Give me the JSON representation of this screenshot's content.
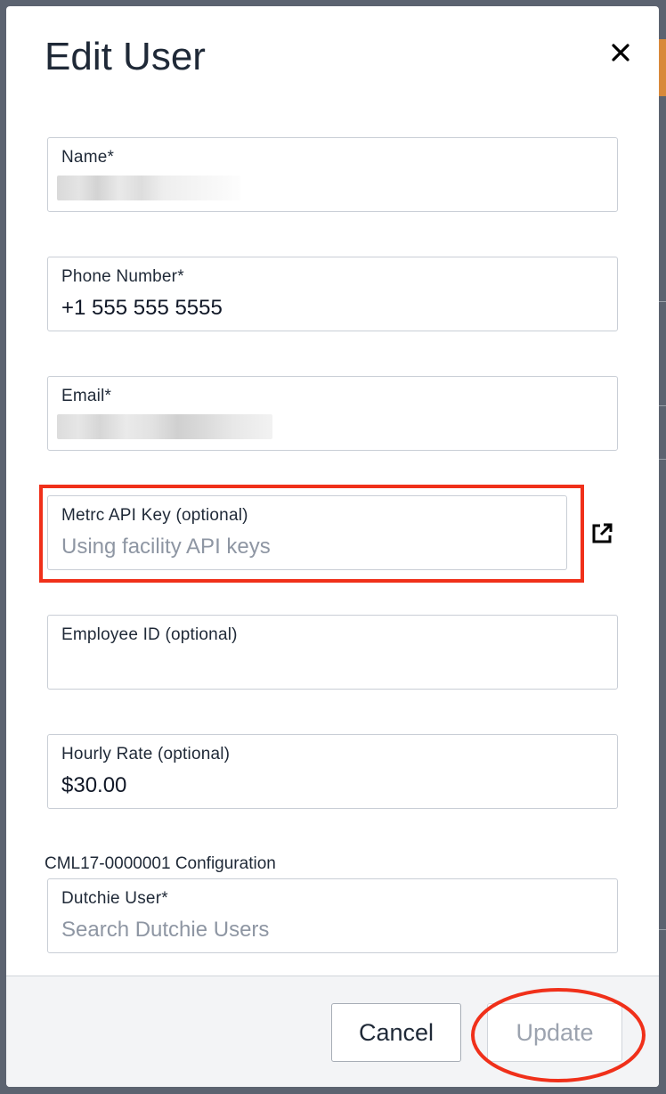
{
  "modal": {
    "title": "Edit User"
  },
  "fields": {
    "name": {
      "label": "Name*",
      "value": ""
    },
    "phone": {
      "label": "Phone Number*",
      "value": "+1 555 555 5555"
    },
    "email": {
      "label": "Email*",
      "value": ""
    },
    "metrc_api_key": {
      "label": "Metrc API Key (optional)",
      "placeholder": "Using facility API keys"
    },
    "employee_id": {
      "label": "Employee ID (optional)",
      "value": ""
    },
    "hourly_rate": {
      "label": "Hourly Rate (optional)",
      "value": "$30.00"
    }
  },
  "configuration": {
    "section_label": "CML17-0000001 Configuration",
    "dutchie_user": {
      "label": "Dutchie User*",
      "placeholder": "Search Dutchie Users"
    }
  },
  "footer": {
    "cancel_label": "Cancel",
    "update_label": "Update"
  },
  "icons": {
    "close": "close-icon",
    "external_link": "external-link-icon"
  },
  "colors": {
    "annotation": "#f0301a",
    "placeholder": "#8e96a3",
    "disabled_text": "#9ca3af"
  }
}
